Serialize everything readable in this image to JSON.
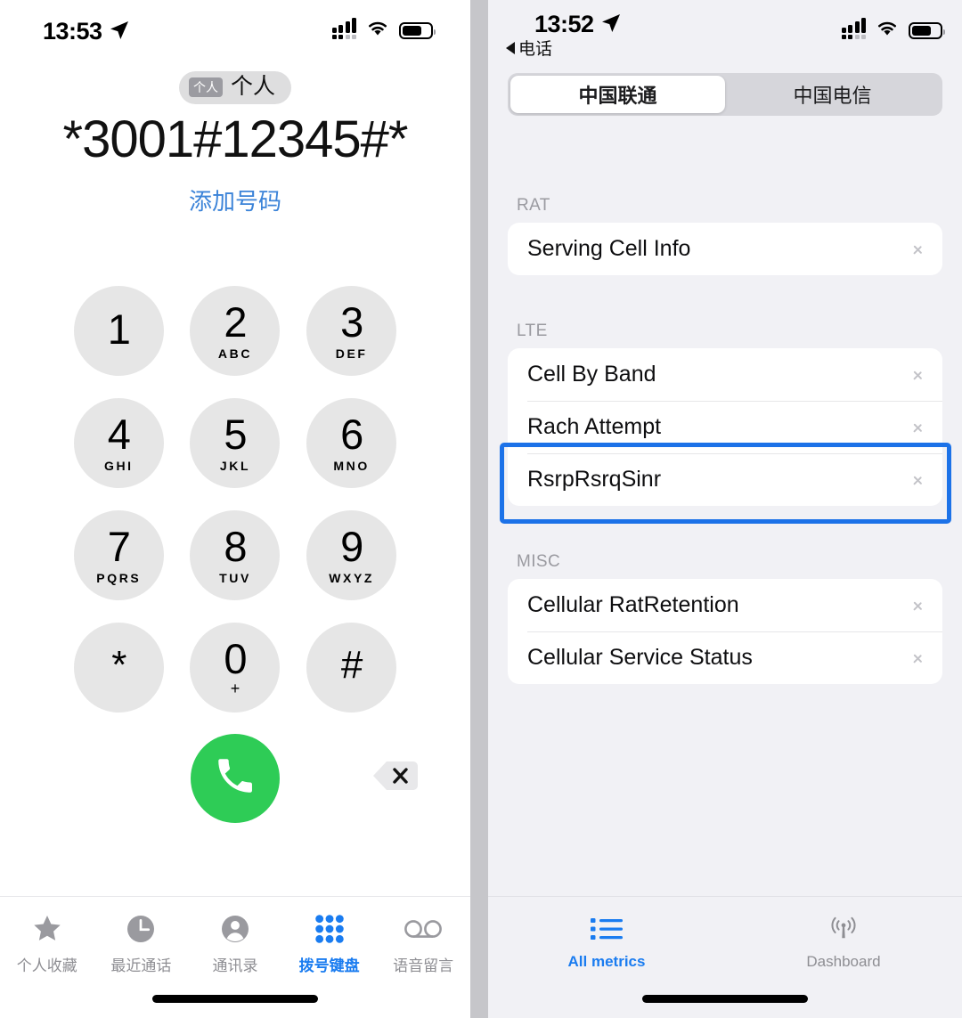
{
  "left_phone": {
    "status_bar": {
      "time": "13:53",
      "location_icon": "location-arrow-icon",
      "signal_icon": "cellular-signal-icon",
      "wifi_icon": "wifi-icon",
      "battery_icon": "battery-icon"
    },
    "dialer": {
      "sim_chip_label": "个人",
      "sim_name": "个人",
      "number": "*3001#12345#*",
      "add_number_label": "添加号码",
      "keys": [
        {
          "digit": "1",
          "letters": ""
        },
        {
          "digit": "2",
          "letters": "ABC"
        },
        {
          "digit": "3",
          "letters": "DEF"
        },
        {
          "digit": "4",
          "letters": "GHI"
        },
        {
          "digit": "5",
          "letters": "JKL"
        },
        {
          "digit": "6",
          "letters": "MNO"
        },
        {
          "digit": "7",
          "letters": "PQRS"
        },
        {
          "digit": "8",
          "letters": "TUV"
        },
        {
          "digit": "9",
          "letters": "WXYZ"
        },
        {
          "digit": "*",
          "letters": ""
        },
        {
          "digit": "0",
          "letters": "+"
        },
        {
          "digit": "#",
          "letters": ""
        }
      ],
      "call_button_icon": "phone-handset-icon",
      "delete_button_icon": "delete-backspace-icon"
    },
    "tabbar": {
      "items": [
        {
          "label": "个人收藏",
          "icon": "star-icon",
          "active": false
        },
        {
          "label": "最近通话",
          "icon": "clock-icon",
          "active": false
        },
        {
          "label": "通讯录",
          "icon": "contact-person-icon",
          "active": false
        },
        {
          "label": "拨号键盘",
          "icon": "keypad-grid-icon",
          "active": true
        },
        {
          "label": "语音留言",
          "icon": "voicemail-icon",
          "active": false
        }
      ]
    }
  },
  "right_phone": {
    "status_bar": {
      "time": "13:52",
      "back_label": "电话",
      "location_icon": "location-arrow-icon",
      "signal_icon": "cellular-signal-icon",
      "wifi_icon": "wifi-icon",
      "battery_icon": "battery-icon"
    },
    "segmented": {
      "options": [
        "中国联通",
        "中国电信"
      ],
      "selected_index": 0
    },
    "sections": [
      {
        "header": "RAT",
        "rows": [
          {
            "label": "Serving Cell Info",
            "highlighted": false
          }
        ]
      },
      {
        "header": "LTE",
        "rows": [
          {
            "label": "Cell By Band",
            "highlighted": false
          },
          {
            "label": "Rach Attempt",
            "highlighted": false
          },
          {
            "label": "RsrpRsrqSinr",
            "highlighted": true
          }
        ]
      },
      {
        "header": "MISC",
        "rows": [
          {
            "label": "Cellular RatRetention",
            "highlighted": false
          },
          {
            "label": "Cellular Service Status",
            "highlighted": false
          }
        ]
      }
    ],
    "tabbar": {
      "items": [
        {
          "label": "All metrics",
          "icon": "list-bullet-icon",
          "active": true
        },
        {
          "label": "Dashboard",
          "icon": "antenna-signal-icon",
          "active": false
        }
      ]
    }
  },
  "colors": {
    "accent_blue": "#1a7cf0",
    "link_blue": "#3b83d8",
    "call_green": "#2ecc56",
    "highlight_border": "#1c72e8",
    "key_gray": "#e6e6e6",
    "right_bg": "#f1f1f5"
  }
}
